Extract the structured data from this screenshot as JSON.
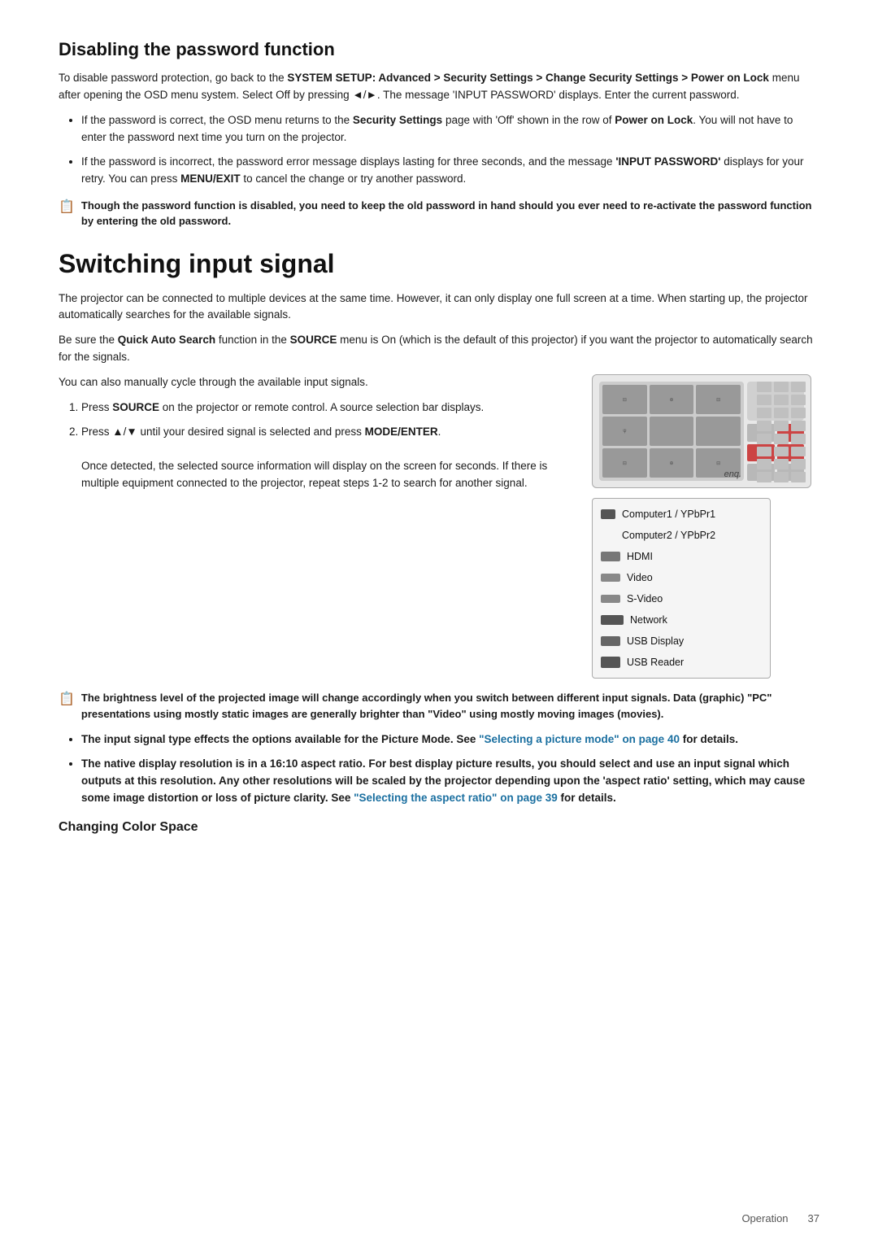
{
  "page": {
    "sections": [
      {
        "id": "disable-password",
        "title": "Disabling the password function",
        "intro": "To disable password protection, go back to the SYSTEM SETUP: Advanced > Security Settings > Change Security Settings > Power on Lock menu after opening the OSD menu system. Select Off by pressing ◄/►. The message 'INPUT PASSWORD' displays. Enter the current password.",
        "bullets": [
          "If the password is correct, the OSD menu returns to the Security Settings page with 'Off' shown in the row of Power on Lock. You will not have to enter the password next time you turn on the projector.",
          "If the password is incorrect, the password error message displays lasting for three seconds, and the message 'INPUT PASSWORD' displays for your retry. You can press MENU/EXIT to cancel the change or try another password."
        ],
        "note": "Though the password function is disabled, you need to keep the old password in hand should you ever need to re-activate the password function by entering the old password."
      },
      {
        "id": "switching-input",
        "title": "Switching input signal",
        "paragraphs": [
          "The projector can be connected to multiple devices at the same time. However, it can only display one full screen at a time. When starting up, the projector automatically searches for the available signals.",
          "Be sure the Quick Auto Search function in the SOURCE menu is On (which is the default of this projector) if you want the projector to automatically search for the signals.",
          "You can also manually cycle through the available input signals."
        ],
        "steps": [
          {
            "num": "1.",
            "text": "Press SOURCE on the projector or remote control. A source selection bar displays."
          },
          {
            "num": "2.",
            "text": "Press ▲/▼ until your desired signal is selected and press MODE/ENTER.",
            "sub": "Once detected, the selected source information will display on the screen for seconds. If there is multiple equipment connected to the projector, repeat steps 1-2 to search for another signal."
          }
        ],
        "note1": "The brightness level of the projected image will change accordingly when you switch between different input signals. Data (graphic) \"PC\" presentations using mostly static images are generally brighter than \"Video\" using mostly moving images (movies).",
        "bullet2": "The input signal type effects the options available for the Picture Mode. See \"Selecting a picture mode\" on page 40 for details.",
        "bullet3": "The native display resolution is in a 16:10 aspect ratio. For best display picture results, you should select and use an input signal which outputs at this resolution. Any other resolutions will be scaled by the projector depending upon the 'aspect ratio' setting, which may cause some image distortion or loss of picture clarity. See \"Selecting the aspect ratio\" on page 39 for details.",
        "subheading": "Changing Color Space",
        "source_menu": {
          "items": [
            {
              "label": "Computer1 / YPbPr1",
              "icon_type": "usb",
              "selected": false
            },
            {
              "label": "Computer2 / YPbPr2",
              "icon_type": "usb",
              "selected": false
            },
            {
              "label": "HDMI",
              "icon_type": "hdmi",
              "selected": false
            },
            {
              "label": "Video",
              "icon_type": "default",
              "selected": false
            },
            {
              "label": "S-Video",
              "icon_type": "default",
              "selected": false
            },
            {
              "label": "Network",
              "icon_type": "network",
              "selected": false
            },
            {
              "label": "USB Display",
              "icon_type": "usb",
              "selected": false
            },
            {
              "label": "USB Reader",
              "icon_type": "usb",
              "selected": false
            }
          ]
        }
      }
    ],
    "footer": {
      "section_label": "Operation",
      "page_number": "37"
    },
    "link_texts": {
      "selecting_picture_mode": "Selecting a picture mode\" on page 40",
      "selecting_aspect_ratio": "Selecting the aspect ratio\" on page 39"
    }
  }
}
